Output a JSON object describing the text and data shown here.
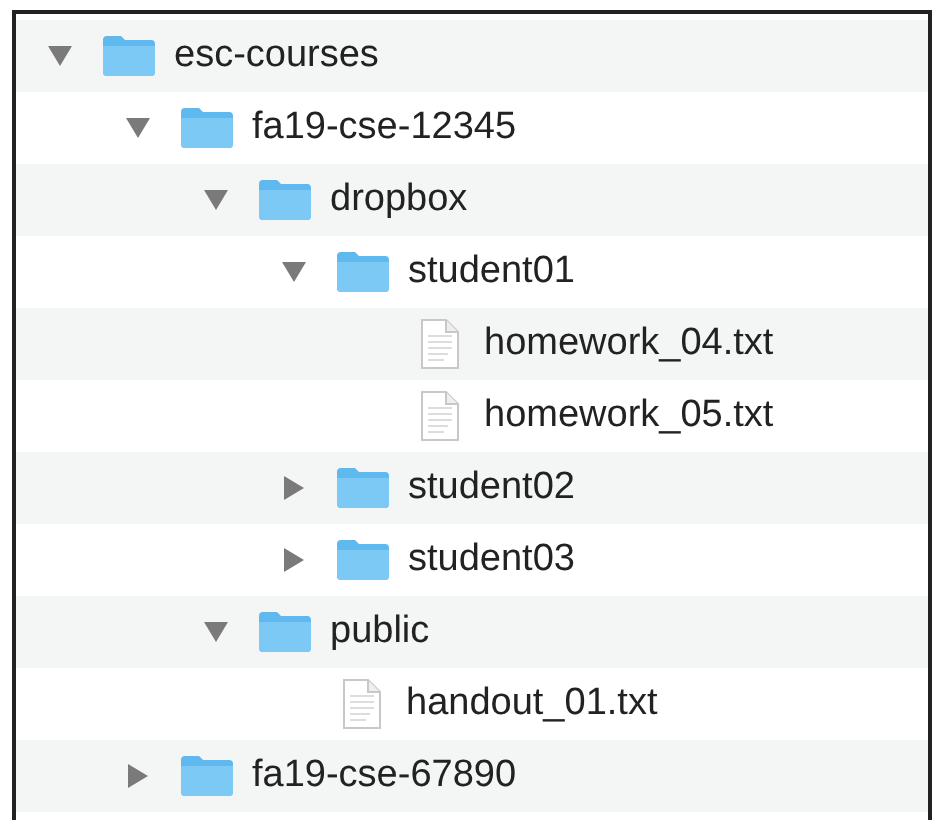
{
  "tree": [
    {
      "kind": "folder",
      "name": "esc-courses",
      "expanded": true,
      "children": [
        {
          "kind": "folder",
          "name": "fa19-cse-12345",
          "expanded": true,
          "children": [
            {
              "kind": "folder",
              "name": "dropbox",
              "expanded": true,
              "children": [
                {
                  "kind": "folder",
                  "name": "student01",
                  "expanded": true,
                  "children": [
                    {
                      "kind": "file",
                      "name": "homework_04.txt"
                    },
                    {
                      "kind": "file",
                      "name": "homework_05.txt"
                    }
                  ]
                },
                {
                  "kind": "folder",
                  "name": "student02",
                  "expanded": false
                },
                {
                  "kind": "folder",
                  "name": "student03",
                  "expanded": false
                }
              ]
            },
            {
              "kind": "folder",
              "name": "public",
              "expanded": true,
              "children": [
                {
                  "kind": "file",
                  "name": "handout_01.txt"
                }
              ]
            }
          ]
        },
        {
          "kind": "folder",
          "name": "fa19-cse-67890",
          "expanded": false
        }
      ]
    }
  ]
}
